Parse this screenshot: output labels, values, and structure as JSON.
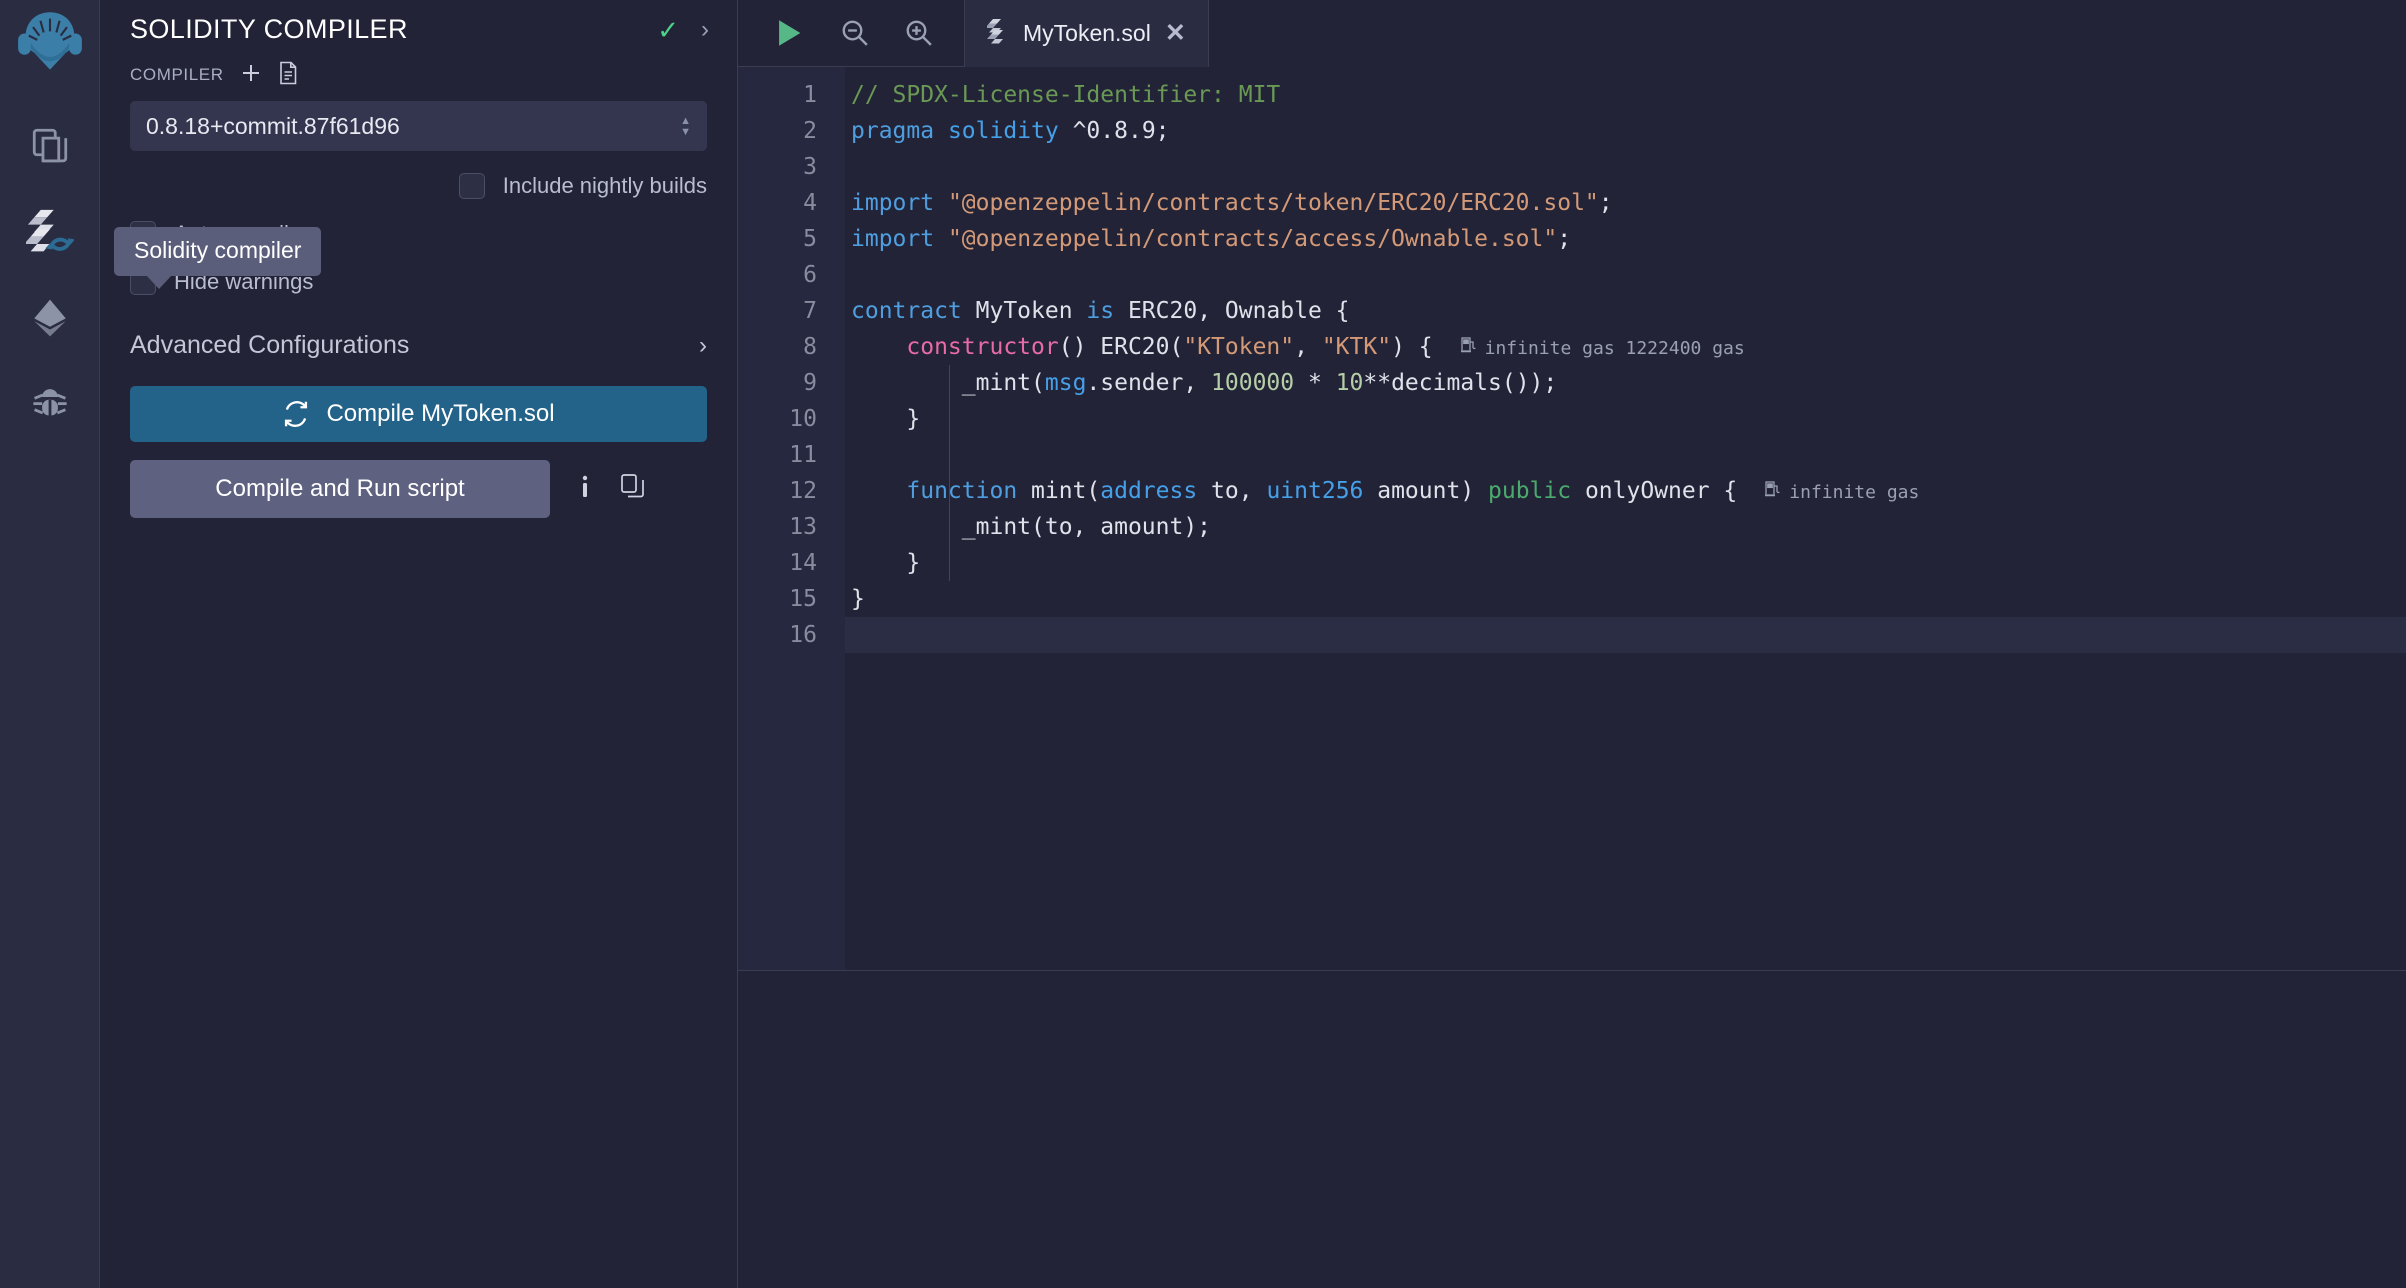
{
  "rail": {
    "logo_name": "remix-logo",
    "items": [
      {
        "name": "file-explorer-icon",
        "label": "File explorer"
      },
      {
        "name": "solidity-compiler-icon",
        "label": "Solidity compiler"
      },
      {
        "name": "deploy-run-icon",
        "label": "Deploy & run transactions"
      },
      {
        "name": "debugger-icon",
        "label": "Debugger"
      }
    ]
  },
  "tooltip": {
    "text": "Solidity compiler"
  },
  "panel": {
    "title": "SOLIDITY COMPILER",
    "check_icon": "check-icon",
    "expand_icon": "chevron-right-icon",
    "compiler_label": "COMPILER",
    "add_icon": "plus-icon",
    "file_icon": "document-icon",
    "version": "0.8.18+commit.87f61d96",
    "options": [
      {
        "label": "Include nightly builds",
        "checked": false,
        "align": "right"
      },
      {
        "label": "Auto compile",
        "checked": false,
        "align": "left"
      },
      {
        "label": "Hide warnings",
        "checked": false,
        "align": "left"
      }
    ],
    "advanced": "Advanced Configurations",
    "compile_button": "Compile MyToken.sol",
    "compile_icon": "refresh-icon",
    "run_button": "Compile and Run script",
    "info_icon": "info-icon",
    "copy_icon": "copy-icon"
  },
  "editor": {
    "toolbar": [
      {
        "name": "run-script-icon",
        "label": "Run"
      },
      {
        "name": "zoom-out-icon",
        "label": "Zoom out"
      },
      {
        "name": "zoom-in-icon",
        "label": "Zoom in"
      }
    ],
    "tab": {
      "file_icon": "solidity-file-icon",
      "name": "MyToken.sol",
      "close_icon": "close-icon"
    },
    "active_line": 16,
    "line_numbers": [
      1,
      2,
      3,
      4,
      5,
      6,
      7,
      8,
      9,
      10,
      11,
      12,
      13,
      14,
      15,
      16
    ],
    "lines": [
      {
        "n": 1,
        "tokens": [
          {
            "t": "// SPDX-License-Identifier: MIT",
            "c": "tok-comment"
          }
        ]
      },
      {
        "n": 2,
        "tokens": [
          {
            "t": "pragma",
            "c": "tok-kw"
          },
          {
            "t": " ",
            "c": "tok-plain"
          },
          {
            "t": "solidity",
            "c": "tok-kw2"
          },
          {
            "t": " ^0.8.9;",
            "c": "tok-plain"
          }
        ]
      },
      {
        "n": 3,
        "tokens": []
      },
      {
        "n": 4,
        "tokens": [
          {
            "t": "import",
            "c": "tok-kw"
          },
          {
            "t": " ",
            "c": "tok-plain"
          },
          {
            "t": "\"@openzeppelin/contracts/token/ERC20/ERC20.sol\"",
            "c": "tok-str"
          },
          {
            "t": ";",
            "c": "tok-plain"
          }
        ]
      },
      {
        "n": 5,
        "tokens": [
          {
            "t": "import",
            "c": "tok-kw"
          },
          {
            "t": " ",
            "c": "tok-plain"
          },
          {
            "t": "\"@openzeppelin/contracts/access/Ownable.sol\"",
            "c": "tok-str"
          },
          {
            "t": ";",
            "c": "tok-plain"
          }
        ]
      },
      {
        "n": 6,
        "tokens": []
      },
      {
        "n": 7,
        "tokens": [
          {
            "t": "contract",
            "c": "tok-kw"
          },
          {
            "t": " MyToken ",
            "c": "tok-plain"
          },
          {
            "t": "is",
            "c": "tok-kw"
          },
          {
            "t": " ERC20, Ownable {",
            "c": "tok-plain"
          }
        ]
      },
      {
        "n": 8,
        "tokens": [
          {
            "t": "    ",
            "c": "tok-plain"
          },
          {
            "t": "constructor",
            "c": "tok-pink"
          },
          {
            "t": "() ERC20(",
            "c": "tok-plain"
          },
          {
            "t": "\"KToken\"",
            "c": "tok-str"
          },
          {
            "t": ", ",
            "c": "tok-plain"
          },
          {
            "t": "\"KTK\"",
            "c": "tok-str"
          },
          {
            "t": ") {",
            "c": "tok-plain"
          }
        ],
        "gas": "infinite gas 1222400 gas"
      },
      {
        "n": 9,
        "tokens": [
          {
            "t": "        _mint(",
            "c": "tok-plain"
          },
          {
            "t": "msg",
            "c": "tok-kw2"
          },
          {
            "t": ".sender, ",
            "c": "tok-plain"
          },
          {
            "t": "100000",
            "c": "tok-num"
          },
          {
            "t": " * ",
            "c": "tok-plain"
          },
          {
            "t": "10",
            "c": "tok-num"
          },
          {
            "t": "**decimals());",
            "c": "tok-plain"
          }
        ]
      },
      {
        "n": 10,
        "tokens": [
          {
            "t": "    }",
            "c": "tok-plain"
          }
        ]
      },
      {
        "n": 11,
        "tokens": []
      },
      {
        "n": 12,
        "tokens": [
          {
            "t": "    ",
            "c": "tok-plain"
          },
          {
            "t": "function",
            "c": "tok-kw"
          },
          {
            "t": " mint(",
            "c": "tok-plain"
          },
          {
            "t": "address",
            "c": "tok-kw2"
          },
          {
            "t": " to, ",
            "c": "tok-plain"
          },
          {
            "t": "uint256",
            "c": "tok-kw2"
          },
          {
            "t": " amount) ",
            "c": "tok-plain"
          },
          {
            "t": "public",
            "c": "tok-green"
          },
          {
            "t": " onlyOwner {",
            "c": "tok-plain"
          }
        ],
        "gas": "infinite gas"
      },
      {
        "n": 13,
        "tokens": [
          {
            "t": "        _mint(to, amount);",
            "c": "tok-plain"
          }
        ]
      },
      {
        "n": 14,
        "tokens": [
          {
            "t": "    }",
            "c": "tok-plain"
          }
        ]
      },
      {
        "n": 15,
        "tokens": [
          {
            "t": "}",
            "c": "tok-plain"
          }
        ]
      },
      {
        "n": 16,
        "tokens": []
      }
    ]
  },
  "colors": {
    "background": "#222336",
    "panel_border": "#3a3c52",
    "accent_blue": "#236289",
    "tooltip_bg": "#5b5e7b",
    "check_green": "#4cd38a",
    "run_green": "#57b887",
    "gutter_bg": "#262840",
    "active_line_bg": "#2b2d44"
  }
}
